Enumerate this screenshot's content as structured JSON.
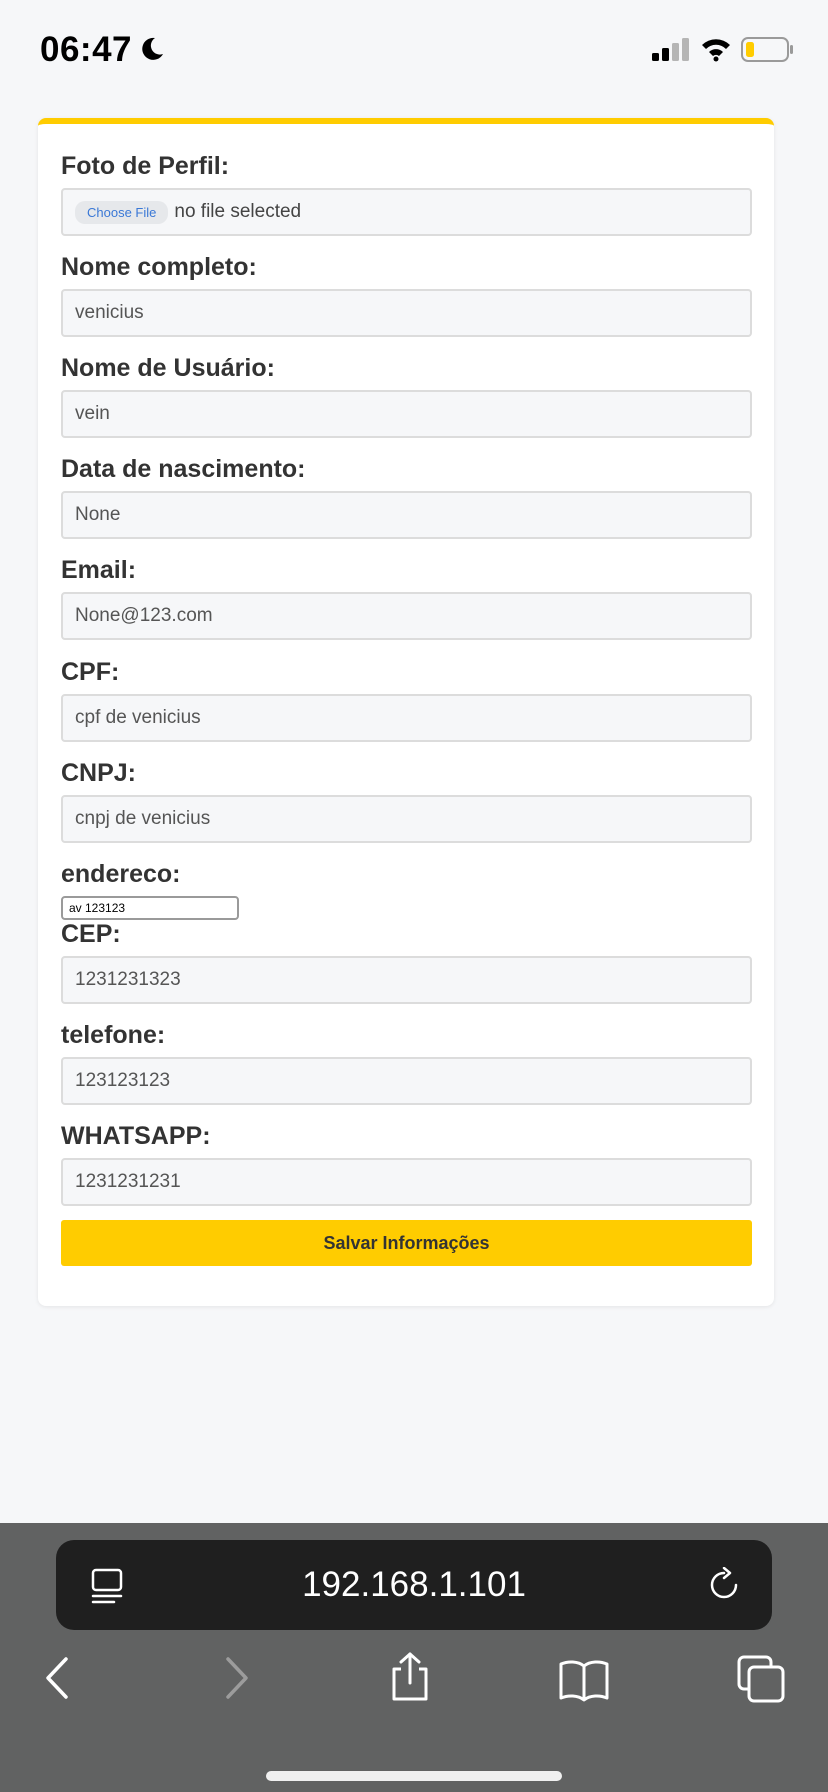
{
  "status_bar": {
    "time": "06:47",
    "icons": [
      "moon-icon",
      "signal-icon",
      "wifi-icon",
      "battery-icon"
    ],
    "battery_color": "#ffcc00"
  },
  "form": {
    "accent_color": "#ffcc00",
    "profile_photo": {
      "label": "Foto de Perfil:",
      "button_label": "Choose File",
      "status": "no file selected"
    },
    "full_name": {
      "label": "Nome completo:",
      "value": "venicius"
    },
    "username": {
      "label": "Nome de Usuário:",
      "value": "vein"
    },
    "birth_date": {
      "label": "Data de nascimento:",
      "value": "None"
    },
    "email": {
      "label": "Email:",
      "value": "None@123.com"
    },
    "cpf": {
      "label": "CPF:",
      "value": "cpf de venicius"
    },
    "cnpj": {
      "label": "CNPJ:",
      "value": "cnpj de venicius"
    },
    "address": {
      "label": "endereco:",
      "value": "av 123123"
    },
    "cep": {
      "label": "CEP:",
      "value": "1231231323"
    },
    "phone": {
      "label": "telefone:",
      "value": "123123123"
    },
    "whatsapp": {
      "label": "WHATSAPP:",
      "value": "1231231231"
    },
    "save_label": "Salvar Informações"
  },
  "browser": {
    "url": "192.168.1.101",
    "toolbar_icons": [
      "back-icon",
      "forward-icon",
      "share-icon",
      "bookmarks-icon",
      "tabs-icon"
    ]
  }
}
